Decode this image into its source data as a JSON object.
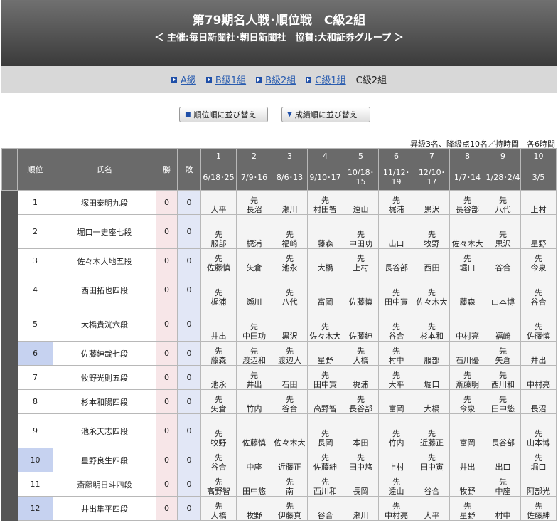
{
  "header": {
    "title": "第79期名人戦･順位戦　C級2組",
    "subtitle": "＜ 主催:毎日新聞社･朝日新聞社　協賛:大和証券グループ ＞"
  },
  "nav": {
    "links": [
      "A級",
      "B級1組",
      "B級2組",
      "C級1組"
    ],
    "current": "C級2組"
  },
  "sort_buttons": {
    "rank_label": "順位順に並び替え",
    "score_label": "成績順に並び替え"
  },
  "note": "昇級3名、降級点10名／持時間　各6時間",
  "table": {
    "headers": {
      "rank": "順位",
      "name": "氏名",
      "win": "勝",
      "loss": "敗"
    },
    "rounds": [
      "1",
      "2",
      "3",
      "4",
      "5",
      "6",
      "7",
      "8",
      "9",
      "10"
    ],
    "dates": [
      "6/18･25",
      "7/9･16",
      "8/6･13",
      "9/10･17",
      "10/18･15",
      "11/12･19",
      "12/10･17",
      "1/7･14",
      "1/28･2/4",
      "3/5"
    ],
    "sente_mark": "先",
    "rows": [
      {
        "rank": "1",
        "name": "塚田泰明九段",
        "win": "0",
        "loss": "0",
        "highlight": false,
        "games": [
          {
            "s": false,
            "o": "大平"
          },
          {
            "s": true,
            "o": "長沼"
          },
          {
            "s": false,
            "o": "瀬川"
          },
          {
            "s": true,
            "o": "村田智"
          },
          {
            "s": false,
            "o": "遠山"
          },
          {
            "s": true,
            "o": "梶浦"
          },
          {
            "s": false,
            "o": "黒沢"
          },
          {
            "s": true,
            "o": "長谷部"
          },
          {
            "s": true,
            "o": "八代"
          },
          {
            "s": false,
            "o": "上村"
          }
        ]
      },
      {
        "rank": "2",
        "name": "堀口一史座七段",
        "win": "0",
        "loss": "0",
        "highlight": false,
        "games": [
          {
            "s": true,
            "o": "服部"
          },
          {
            "s": false,
            "o": "梶浦"
          },
          {
            "s": true,
            "o": "福崎"
          },
          {
            "s": false,
            "o": "藤森"
          },
          {
            "s": true,
            "o": "中田功"
          },
          {
            "s": false,
            "o": "出口"
          },
          {
            "s": true,
            "o": "牧野"
          },
          {
            "s": false,
            "o": "佐々木大"
          },
          {
            "s": true,
            "o": "黒沢"
          },
          {
            "s": false,
            "o": "星野"
          }
        ]
      },
      {
        "rank": "3",
        "name": "佐々木大地五段",
        "win": "0",
        "loss": "0",
        "highlight": false,
        "games": [
          {
            "s": true,
            "o": "佐藤慎"
          },
          {
            "s": false,
            "o": "矢倉"
          },
          {
            "s": true,
            "o": "池永"
          },
          {
            "s": false,
            "o": "大橋"
          },
          {
            "s": true,
            "o": "上村"
          },
          {
            "s": false,
            "o": "長谷部"
          },
          {
            "s": false,
            "o": "西田"
          },
          {
            "s": true,
            "o": "堀口"
          },
          {
            "s": false,
            "o": "谷合"
          },
          {
            "s": true,
            "o": "今泉"
          }
        ]
      },
      {
        "rank": "4",
        "name": "西田拓也四段",
        "win": "0",
        "loss": "0",
        "highlight": false,
        "games": [
          {
            "s": true,
            "o": "梶浦"
          },
          {
            "s": false,
            "o": "瀬川"
          },
          {
            "s": true,
            "o": "八代"
          },
          {
            "s": false,
            "o": "富岡"
          },
          {
            "s": false,
            "o": "佐藤慎"
          },
          {
            "s": true,
            "o": "田中寅"
          },
          {
            "s": true,
            "o": "佐々木大"
          },
          {
            "s": false,
            "o": "藤森"
          },
          {
            "s": false,
            "o": "山本博"
          },
          {
            "s": true,
            "o": "谷合"
          }
        ]
      },
      {
        "rank": "5",
        "name": "大橋貴洸六段",
        "win": "0",
        "loss": "0",
        "highlight": false,
        "games": [
          {
            "s": false,
            "o": "井出"
          },
          {
            "s": true,
            "o": "中田功"
          },
          {
            "s": false,
            "o": "黒沢"
          },
          {
            "s": true,
            "o": "佐々木大"
          },
          {
            "s": false,
            "o": "佐藤紳"
          },
          {
            "s": true,
            "o": "谷合"
          },
          {
            "s": true,
            "o": "杉本和"
          },
          {
            "s": false,
            "o": "中村亮"
          },
          {
            "s": false,
            "o": "福崎"
          },
          {
            "s": true,
            "o": "佐藤慎"
          }
        ]
      },
      {
        "rank": "6",
        "name": "佐藤紳哉七段",
        "win": "0",
        "loss": "0",
        "highlight": true,
        "games": [
          {
            "s": true,
            "o": "藤森"
          },
          {
            "s": true,
            "o": "渡辺和"
          },
          {
            "s": true,
            "o": "渡辺大"
          },
          {
            "s": false,
            "o": "星野"
          },
          {
            "s": true,
            "o": "大橋"
          },
          {
            "s": true,
            "o": "村中"
          },
          {
            "s": false,
            "o": "服部"
          },
          {
            "s": false,
            "o": "石川優"
          },
          {
            "s": true,
            "o": "矢倉"
          },
          {
            "s": false,
            "o": "井出"
          }
        ]
      },
      {
        "rank": "7",
        "name": "牧野光則五段",
        "win": "0",
        "loss": "0",
        "highlight": false,
        "games": [
          {
            "s": false,
            "o": "池永"
          },
          {
            "s": true,
            "o": "井出"
          },
          {
            "s": false,
            "o": "石田"
          },
          {
            "s": true,
            "o": "田中寅"
          },
          {
            "s": false,
            "o": "梶浦"
          },
          {
            "s": true,
            "o": "大平"
          },
          {
            "s": false,
            "o": "堀口"
          },
          {
            "s": true,
            "o": "斎藤明"
          },
          {
            "s": true,
            "o": "西川和"
          },
          {
            "s": false,
            "o": "中村亮"
          }
        ]
      },
      {
        "rank": "8",
        "name": "杉本和陽四段",
        "win": "0",
        "loss": "0",
        "highlight": false,
        "games": [
          {
            "s": true,
            "o": "矢倉"
          },
          {
            "s": false,
            "o": "竹内"
          },
          {
            "s": true,
            "o": "谷合"
          },
          {
            "s": false,
            "o": "高野智"
          },
          {
            "s": true,
            "o": "長谷部"
          },
          {
            "s": false,
            "o": "富岡"
          },
          {
            "s": false,
            "o": "大橋"
          },
          {
            "s": true,
            "o": "今泉"
          },
          {
            "s": true,
            "o": "田中悠"
          },
          {
            "s": false,
            "o": "長沼"
          }
        ]
      },
      {
        "rank": "9",
        "name": "池永天志四段",
        "win": "0",
        "loss": "0",
        "highlight": false,
        "games": [
          {
            "s": true,
            "o": "牧野"
          },
          {
            "s": false,
            "o": "佐藤慎"
          },
          {
            "s": false,
            "o": "佐々木大"
          },
          {
            "s": true,
            "o": "長岡"
          },
          {
            "s": false,
            "o": "本田"
          },
          {
            "s": true,
            "o": "竹内"
          },
          {
            "s": true,
            "o": "近藤正"
          },
          {
            "s": false,
            "o": "富岡"
          },
          {
            "s": false,
            "o": "長谷部"
          },
          {
            "s": true,
            "o": "山本博"
          }
        ]
      },
      {
        "rank": "10",
        "name": "星野良生四段",
        "win": "0",
        "loss": "0",
        "highlight": true,
        "games": [
          {
            "s": true,
            "o": "谷合"
          },
          {
            "s": false,
            "o": "中座"
          },
          {
            "s": false,
            "o": "近藤正"
          },
          {
            "s": true,
            "o": "佐藤紳"
          },
          {
            "s": true,
            "o": "田中悠"
          },
          {
            "s": false,
            "o": "上村"
          },
          {
            "s": true,
            "o": "田中寅"
          },
          {
            "s": false,
            "o": "井出"
          },
          {
            "s": false,
            "o": "出口"
          },
          {
            "s": true,
            "o": "堀口"
          }
        ]
      },
      {
        "rank": "11",
        "name": "斎藤明日斗四段",
        "win": "0",
        "loss": "0",
        "highlight": false,
        "games": [
          {
            "s": true,
            "o": "高野智"
          },
          {
            "s": false,
            "o": "田中悠"
          },
          {
            "s": true,
            "o": "南"
          },
          {
            "s": true,
            "o": "西川和"
          },
          {
            "s": false,
            "o": "長岡"
          },
          {
            "s": true,
            "o": "遠山"
          },
          {
            "s": false,
            "o": "谷合"
          },
          {
            "s": false,
            "o": "牧野"
          },
          {
            "s": true,
            "o": "中座"
          },
          {
            "s": false,
            "o": "阿部光"
          }
        ]
      },
      {
        "rank": "12",
        "name": "井出隼平四段",
        "win": "0",
        "loss": "0",
        "highlight": true,
        "games": [
          {
            "s": true,
            "o": "大橋"
          },
          {
            "s": false,
            "o": "牧野"
          },
          {
            "s": true,
            "o": "伊藤真"
          },
          {
            "s": false,
            "o": "谷合"
          },
          {
            "s": false,
            "o": "瀬川"
          },
          {
            "s": true,
            "o": "中村亮"
          },
          {
            "s": false,
            "o": "大平"
          },
          {
            "s": true,
            "o": "星野"
          },
          {
            "s": false,
            "o": "村中"
          },
          {
            "s": true,
            "o": "佐藤紳"
          }
        ]
      }
    ]
  }
}
